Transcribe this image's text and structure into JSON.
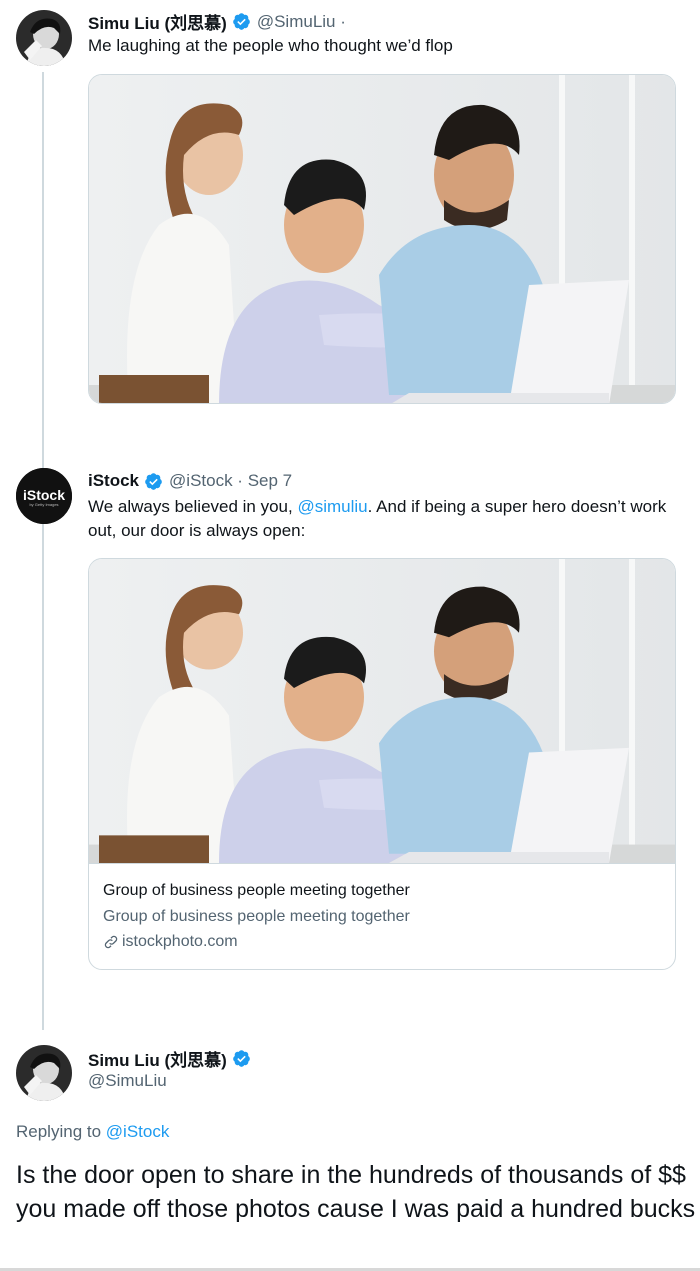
{
  "tweet1": {
    "author_name": "Simu Liu (刘思慕)",
    "handle": "@SimuLiu ·",
    "text": "Me laughing at the people who thought we’d flop",
    "avatar": "person-avatar",
    "verified_icon": "verified-badge-icon"
  },
  "tweet2": {
    "author_name": "iStock",
    "handle": "@iStock · Sep 7",
    "text_before": "We always believed in you, ",
    "mention": "@simuliu",
    "text_after": ". And if being a super hero doesn’t work out, our door is always open:",
    "avatar_logo_text": "iStock",
    "avatar_logo_sub": "by Getty Images",
    "card": {
      "title": "Group of business people meeting together",
      "description": "Group of business people meeting together",
      "domain": "istockphoto.com",
      "domain_icon": "link-icon"
    }
  },
  "reply": {
    "author_name": "Simu Liu (刘思慕)",
    "handle": "@SimuLiu",
    "replying_prefix": "Replying to ",
    "replying_to": "@iStock",
    "text": "Is the door open to share in the hundreds of thousands of $$ you made off those photos cause I was paid a hundred bucks"
  },
  "colors": {
    "link": "#1d9bf0",
    "secondary_text": "#536471",
    "border": "#cfd9de"
  }
}
